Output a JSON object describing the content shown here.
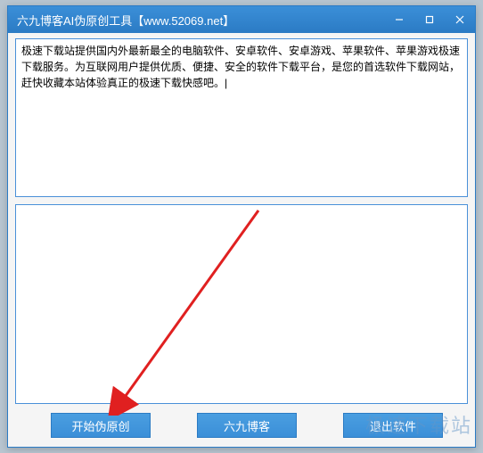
{
  "titlebar": {
    "title": "六九博客AI伪原创工具【www.52069.net】"
  },
  "panels": {
    "input_text": "极速下载站提供国内外最新最全的电脑软件、安卓软件、安卓游戏、苹果软件、苹果游戏极速下载服务。为互联网用户提供优质、便捷、安全的软件下载平台，是您的首选软件下载网站，赶快收藏本站体验真正的极速下载快感吧。|",
    "output_text": ""
  },
  "buttons": {
    "start": "开始伪原创",
    "blog": "六九博客",
    "exit": "退出软件"
  },
  "watermark": "极速下载站"
}
